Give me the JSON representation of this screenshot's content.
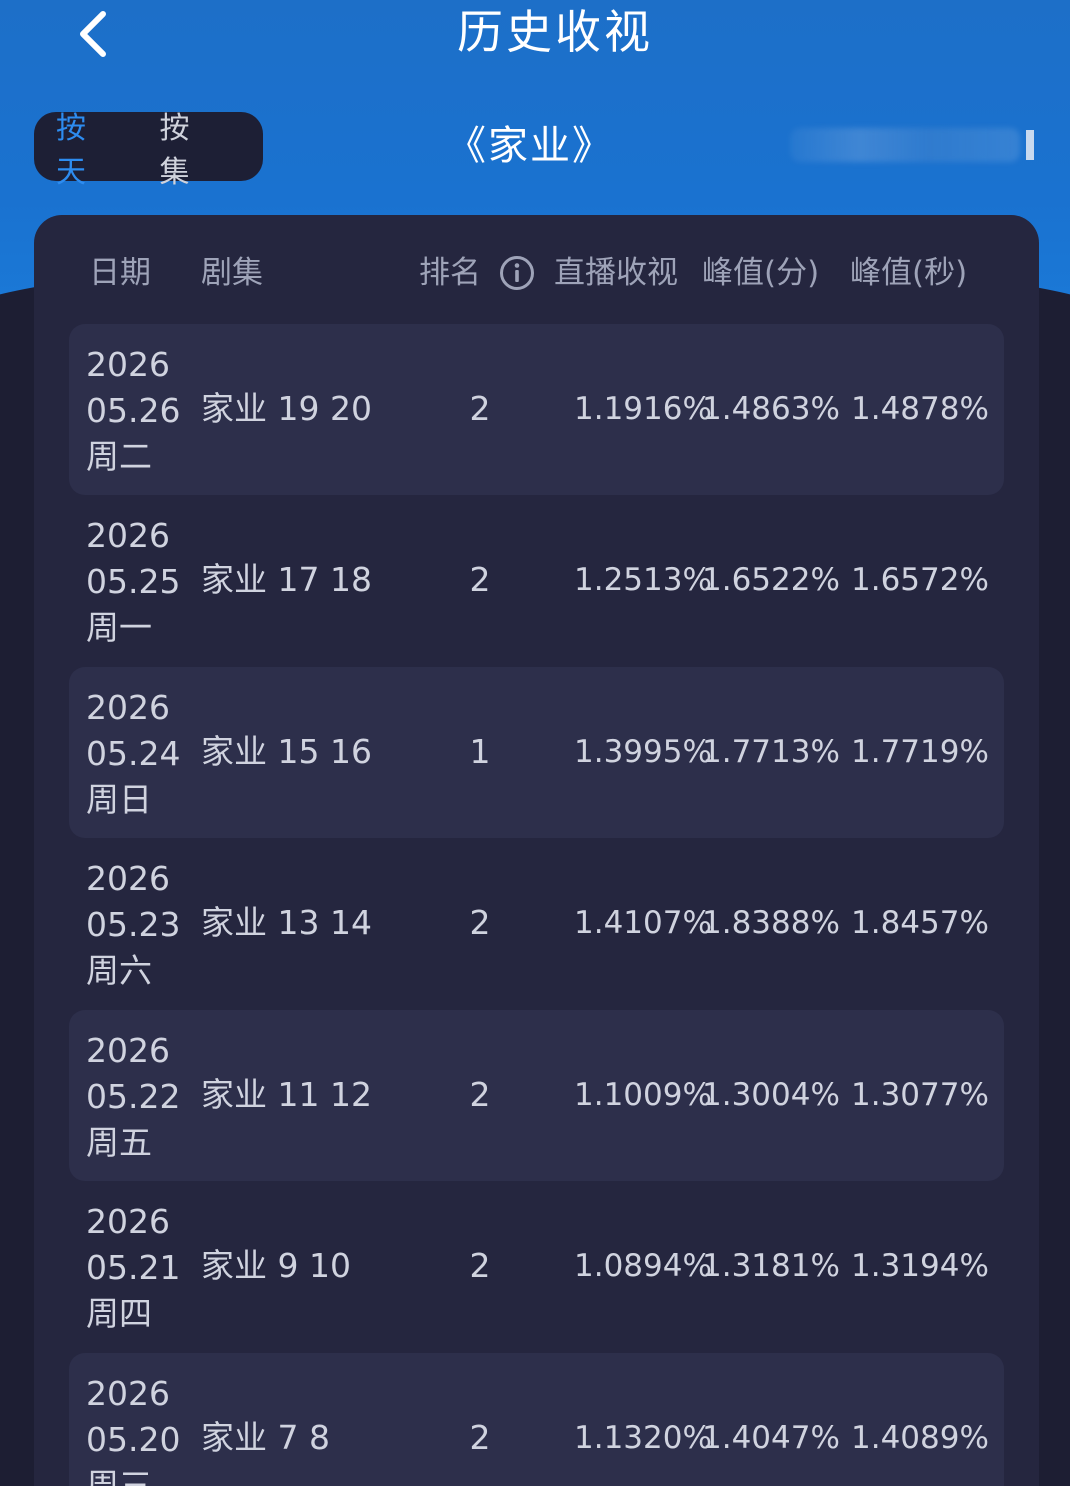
{
  "header": {
    "title": "历史收视",
    "back_icon": "chevron-left-icon"
  },
  "toggle": {
    "by_day": "按天",
    "by_episode": "按集",
    "active": "by_day"
  },
  "show": {
    "title": "《家业》"
  },
  "table": {
    "columns": {
      "date": "日期",
      "episode": "剧集",
      "rank": "排名",
      "live_rating": "直播收视",
      "peak_min": "峰值(分)",
      "peak_sec": "峰值(秒)"
    },
    "info_icon": "info-icon",
    "rows": [
      {
        "year": "2026",
        "date": "05.26",
        "weekday": "周二",
        "episode": "家业 19 20",
        "rank": "2",
        "live": "1.1916%",
        "peak_min": "1.4863%",
        "peak_sec": "1.4878%"
      },
      {
        "year": "2026",
        "date": "05.25",
        "weekday": "周一",
        "episode": "家业 17 18",
        "rank": "2",
        "live": "1.2513%",
        "peak_min": "1.6522%",
        "peak_sec": "1.6572%"
      },
      {
        "year": "2026",
        "date": "05.24",
        "weekday": "周日",
        "episode": "家业 15 16",
        "rank": "1",
        "live": "1.3995%",
        "peak_min": "1.7713%",
        "peak_sec": "1.7719%"
      },
      {
        "year": "2026",
        "date": "05.23",
        "weekday": "周六",
        "episode": "家业 13 14",
        "rank": "2",
        "live": "1.4107%",
        "peak_min": "1.8388%",
        "peak_sec": "1.8457%"
      },
      {
        "year": "2026",
        "date": "05.22",
        "weekday": "周五",
        "episode": "家业 11 12",
        "rank": "2",
        "live": "1.1009%",
        "peak_min": "1.3004%",
        "peak_sec": "1.3077%"
      },
      {
        "year": "2026",
        "date": "05.21",
        "weekday": "周四",
        "episode": "家业 9 10",
        "rank": "2",
        "live": "1.0894%",
        "peak_min": "1.3181%",
        "peak_sec": "1.3194%"
      },
      {
        "year": "2026",
        "date": "05.20",
        "weekday": "周三",
        "episode": "家业 7 8",
        "rank": "2",
        "live": "1.1320%",
        "peak_min": "1.4047%",
        "peak_sec": "1.4089%"
      }
    ]
  },
  "colors": {
    "header_blue": "#1a72d0",
    "background": "#1d1e33",
    "card": "#25263f",
    "row_shaded": "#2d2f4b",
    "accent": "#2d8cf0"
  }
}
